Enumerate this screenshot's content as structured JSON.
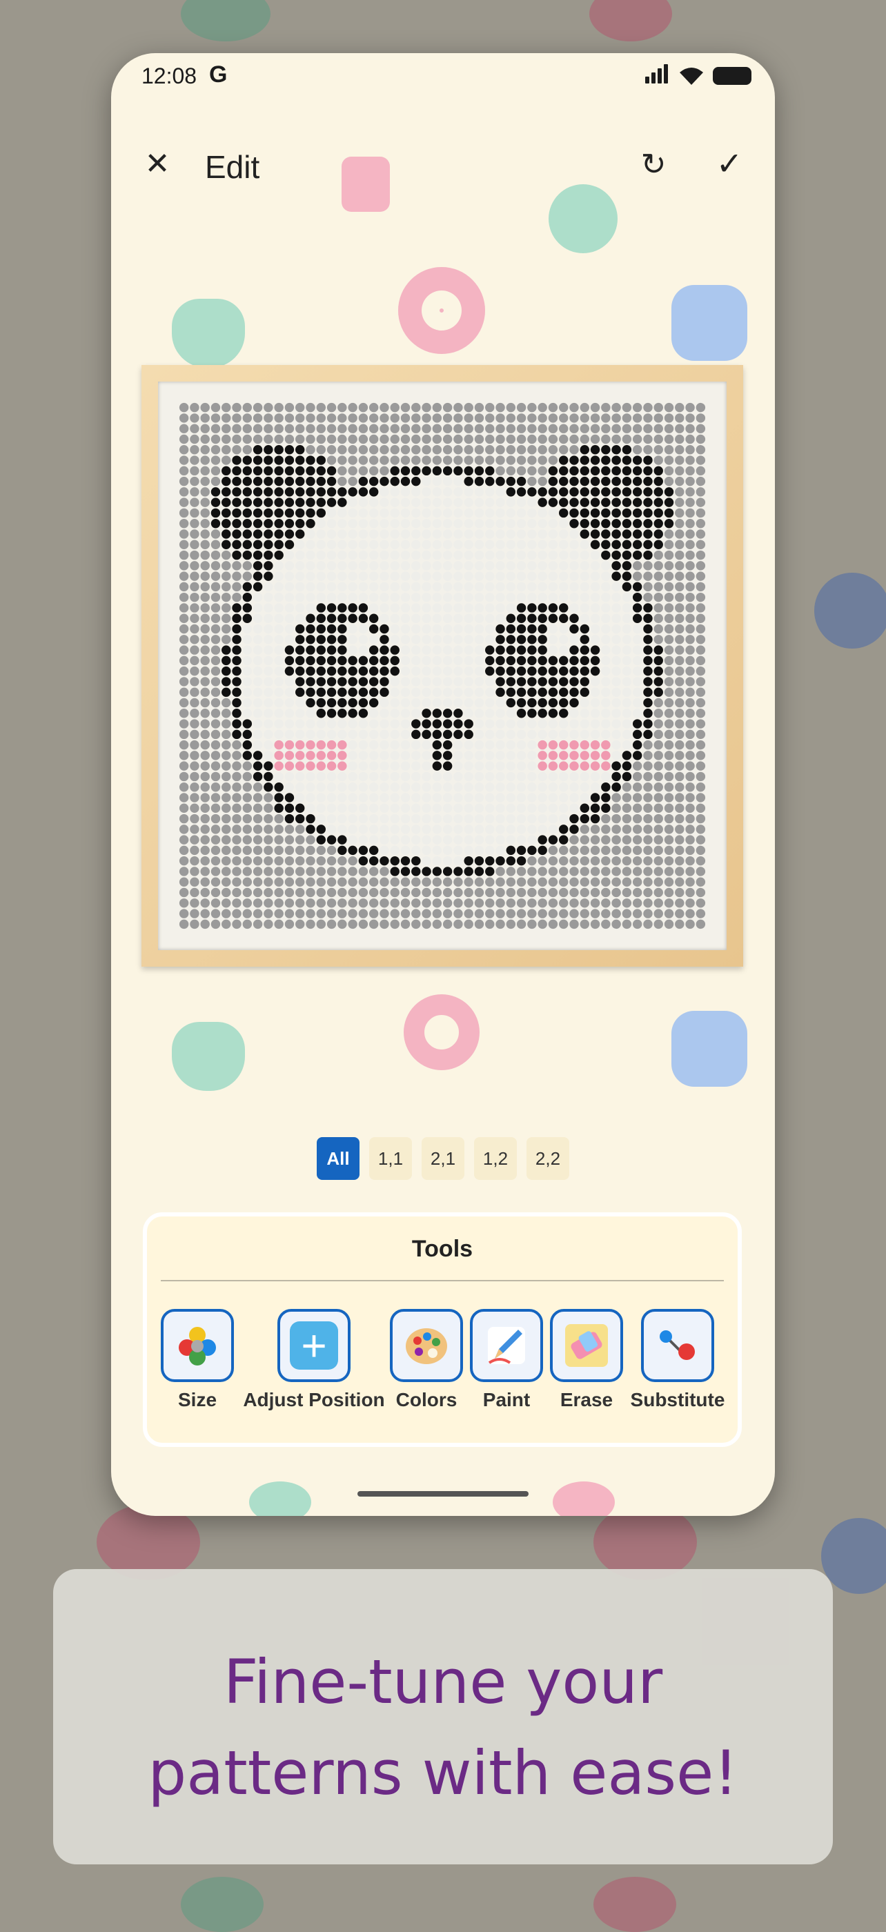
{
  "status_bar": {
    "time": "12:08",
    "g_icon": "G"
  },
  "topbar": {
    "title": "Edit",
    "close_icon": "close-icon",
    "refresh_icon": "refresh-icon",
    "confirm_icon": "checkmark-icon"
  },
  "tabs": [
    {
      "label": "All",
      "active": true
    },
    {
      "label": "1,1",
      "active": false
    },
    {
      "label": "2,1",
      "active": false
    },
    {
      "label": "1,2",
      "active": false
    },
    {
      "label": "2,2",
      "active": false
    }
  ],
  "tools": {
    "title": "Tools",
    "items": [
      {
        "label": "Size",
        "icon": "beads-icon"
      },
      {
        "label": "Adjust Position",
        "icon": "plus-icon"
      },
      {
        "label": "Colors",
        "icon": "palette-icon"
      },
      {
        "label": "Paint",
        "icon": "pencil-icon"
      },
      {
        "label": "Erase",
        "icon": "eraser-icon"
      },
      {
        "label": "Substitute",
        "icon": "swap-pins-icon"
      }
    ]
  },
  "caption": {
    "line1": "Fine-tune your",
    "line2": "patterns with ease!"
  },
  "colors": {
    "accent": "#1565c0",
    "caption_text": "#6b2a85",
    "screen_bg": "#fbf5e3",
    "bead_black": "#111111",
    "bead_gray": "#9a9a9a",
    "bead_white": "#eeeeea",
    "bead_pink": "#f09ab0"
  }
}
